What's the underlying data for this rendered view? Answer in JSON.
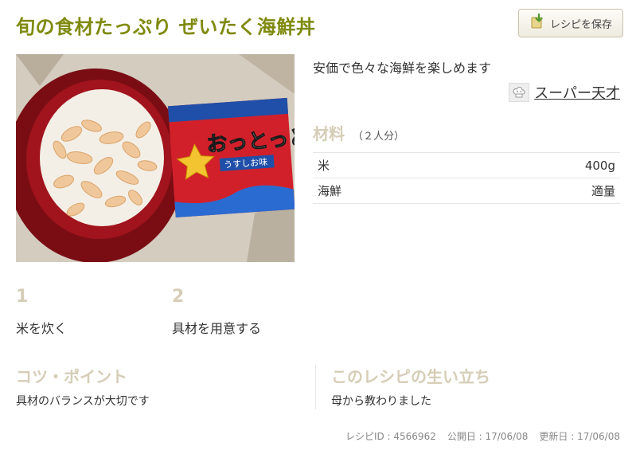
{
  "recipe": {
    "title": "旬の食材たっぷり ぜいたく海鮮丼",
    "description": "安価で色々な海鮮を楽しめます",
    "author": "スーパー天才"
  },
  "save_button": {
    "label": "レシピを保存",
    "icon": "save-recipe-icon"
  },
  "ingredients": {
    "heading": "材料",
    "servings": "（２人分）",
    "items": [
      {
        "name": "米",
        "amount": "400g"
      },
      {
        "name": "海鮮",
        "amount": "適量"
      }
    ]
  },
  "steps": [
    {
      "number": "1",
      "text": "米を炊く"
    },
    {
      "number": "2",
      "text": "具材を用意する"
    }
  ],
  "tips": {
    "heading": "コツ・ポイント",
    "text": "具材のバランスが大切です"
  },
  "history": {
    "heading": "このレシピの生い立ち",
    "text": "母から教わりました"
  },
  "meta": {
    "recipe_id": "レシピID : 4566962",
    "published": "公開日 : 17/06/08",
    "updated": "更新日 : 17/06/08"
  },
  "photo": {
    "bag_text": "おっとっと",
    "bag_subtext": "うすしお味"
  },
  "colors": {
    "title": "#7f8a0d",
    "heading": "#d6cdb7"
  }
}
